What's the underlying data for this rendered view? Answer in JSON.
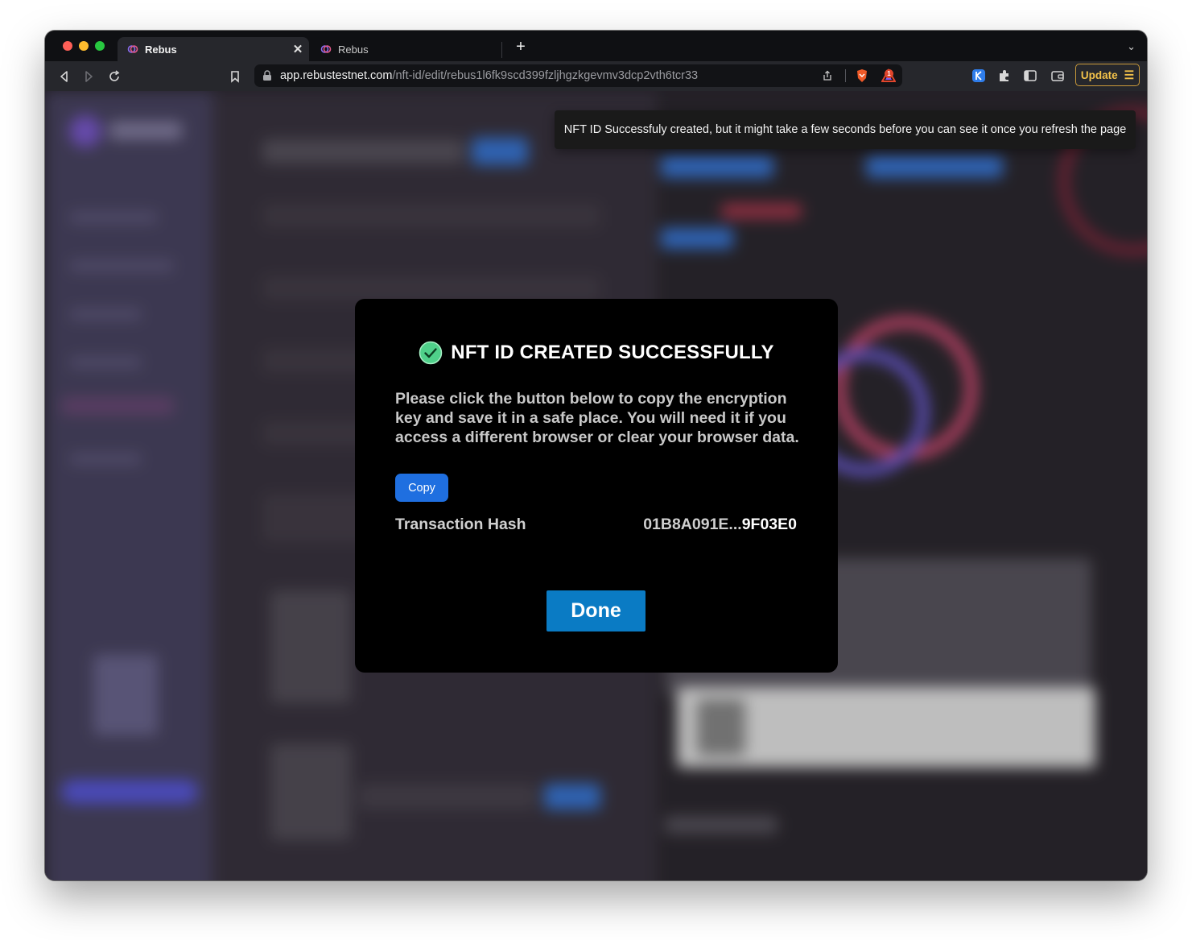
{
  "browser": {
    "tabs": [
      {
        "title": "Rebus",
        "active": true
      },
      {
        "title": "Rebus",
        "active": false
      }
    ],
    "url": {
      "host": "app.rebustestnet.com",
      "path": "/nft-id/edit/rebus1l6fk9scd399fzljhgzkgevmv3dcp2vth6tcr33"
    },
    "rewards_badge": "1",
    "update_label": "Update"
  },
  "toast": {
    "message": "NFT ID Successfuly created, but it might take a few seconds before you can see it once you refresh the page"
  },
  "modal": {
    "title": "NFT ID CREATED SUCCESSFULLY",
    "message": "Please click the button below to copy the encryption key and save it in a safe place. You will need it if you access a different browser or clear your browser data.",
    "copy_label": "Copy",
    "hash_label": "Transaction Hash",
    "hash_prefix": "01B8A091E...",
    "hash_suffix": "9F03E0",
    "done_label": "Done"
  },
  "colors": {
    "accent_blue": "#1f6fe0",
    "done_blue": "#0a7bc4",
    "success_green": "#4fd08a",
    "update_gold": "#f2c14a"
  }
}
